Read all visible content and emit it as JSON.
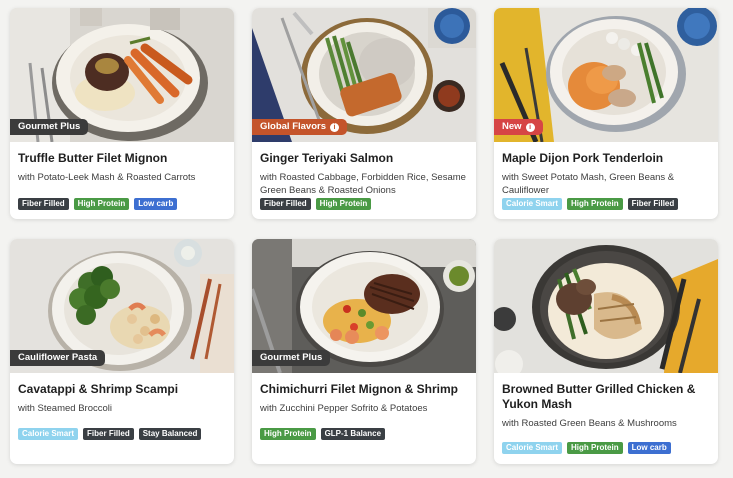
{
  "colors": {
    "tag_fiber": "#3a3f44",
    "tag_protein": "#4a9a45",
    "tag_lowcarb": "#3d6fd1",
    "tag_calorie": "#8fd3ee",
    "tag_balanced": "#3a3f44",
    "tag_glp": "#3a3f44",
    "badge_dark": "#3b3b3b",
    "badge_orange": "#c4542b",
    "badge_red": "#d64545"
  },
  "meals": [
    {
      "badge": "Gourmet Plus",
      "title": "Truffle Butter Filet Mignon",
      "subtitle": "with Potato-Leek Mash & Roasted Carrots",
      "tags": [
        "Fiber Filled",
        "High Protein",
        "Low carb"
      ]
    },
    {
      "badge": "Global Flavors",
      "title": "Ginger Teriyaki Salmon",
      "subtitle": "with Roasted Cabbage, Forbidden Rice, Sesame Green Beans & Roasted Onions",
      "tags": [
        "Fiber Filled",
        "High Protein"
      ]
    },
    {
      "badge": "New",
      "title": "Maple Dijon Pork Tenderloin",
      "subtitle": "with Sweet Potato Mash, Green Beans & Cauliflower",
      "tags": [
        "Calorie Smart",
        "High Protein",
        "Fiber Filled"
      ]
    },
    {
      "badge": "Cauliflower Pasta",
      "title": "Cavatappi & Shrimp Scampi",
      "subtitle": "with Steamed Broccoli",
      "tags": [
        "Calorie Smart",
        "Fiber Filled",
        "Stay Balanced"
      ]
    },
    {
      "badge": "Gourmet Plus",
      "title": "Chimichurri Filet Mignon & Shrimp",
      "subtitle": "with Zucchini Pepper Sofrito & Potatoes",
      "tags": [
        "High Protein",
        "GLP-1 Balance"
      ]
    },
    {
      "badge": "",
      "title": "Browned Butter Grilled Chicken & Yukon Mash",
      "subtitle": "with Roasted Green Beans & Mushrooms",
      "tags": [
        "Calorie Smart",
        "High Protein",
        "Low carb"
      ]
    }
  ]
}
